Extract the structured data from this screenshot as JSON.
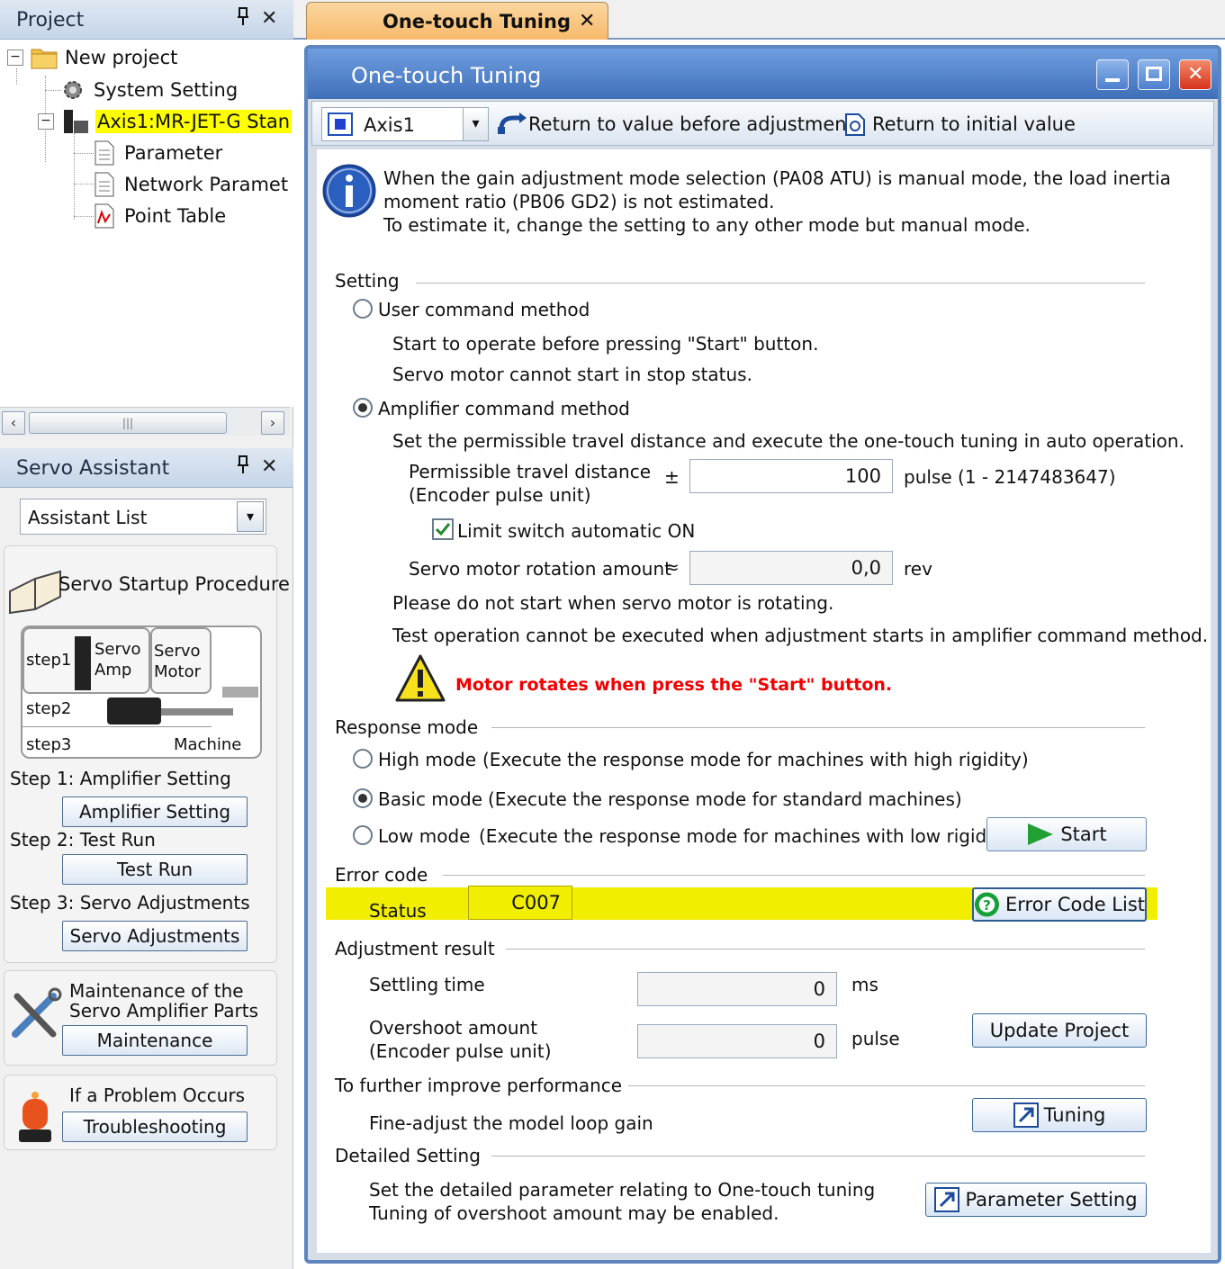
{
  "project_panel": {
    "title": "Project",
    "pin": "⊼",
    "close": "✕",
    "tree": [
      {
        "label": "New project"
      },
      {
        "label": "System Setting"
      },
      {
        "label": "Axis1:MR-JET-G Stan"
      },
      {
        "label": "Parameter"
      },
      {
        "label": "Network Paramet"
      },
      {
        "label": "Point Table"
      }
    ],
    "scroll_mid": "|||"
  },
  "assistant_panel": {
    "title": "Servo Assistant",
    "dropdown_value": "Assistant List",
    "startup": {
      "title": "Servo Startup Procedure",
      "diagram": {
        "step1": "step1",
        "step2": "step2",
        "step3": "step3",
        "servo_amp": "Servo\nAmp",
        "servo_motor": "Servo\nMotor",
        "machine": "Machine"
      },
      "step1_label": "Step 1: Amplifier Setting",
      "step1_button": "Amplifier Setting",
      "step2_label": "Step 2: Test Run",
      "step2_button": "Test Run",
      "step3_label": "Step 3: Servo Adjustments",
      "step3_button": "Servo Adjustments"
    },
    "maintenance": {
      "title1": "Maintenance of the",
      "title2": "Servo Amplifier Parts",
      "button": "Maintenance"
    },
    "problem": {
      "title": "If a Problem Occurs",
      "button": "Troubleshooting"
    }
  },
  "tab": {
    "label": "One-touch Tuning",
    "close": "✕"
  },
  "window": {
    "title": "One-touch Tuning"
  },
  "toolbar": {
    "axis_value": "Axis1",
    "return_before": "Return to value before adjustment",
    "return_initial": "Return to initial value"
  },
  "info": {
    "line1": "When the gain adjustment mode selection (PA08 ATU) is manual mode, the load inertia",
    "line2": "moment ratio (PB06 GD2) is not estimated.",
    "line3": "To estimate it, change the setting to any other mode but manual mode."
  },
  "setting": {
    "header": "Setting",
    "user_method": "User command method",
    "user_desc1": "Start to operate before pressing \"Start\" button.",
    "user_desc2": "Servo motor cannot start in stop status.",
    "amp_method": "Amplifier command method",
    "amp_desc": "Set the permissible travel distance and execute the one-touch tuning in auto operation.",
    "travel_label1": "Permissible travel distance",
    "travel_label2": "(Encoder pulse unit)",
    "plusminus": "±",
    "travel_value": "100",
    "travel_unit": "pulse (1 - 2147483647)",
    "limit_switch": "Limit switch automatic ON",
    "rotation_label": "Servo motor rotation amount",
    "approx": "≈",
    "rotation_value": "0,0",
    "rotation_unit": "rev",
    "note1": "Please do not start when servo motor is rotating.",
    "note2": "Test operation cannot be executed when adjustment starts in amplifier command method.",
    "warning": "Motor rotates when press the \"Start\" button."
  },
  "response": {
    "header": "Response mode",
    "high": "High mode",
    "high_desc": "(Execute the response mode for machines with high rigidity)",
    "basic": "Basic mode",
    "basic_desc": "(Execute the response mode for standard machines)",
    "low": "Low mode",
    "low_desc": "(Execute the response mode for machines with low rigidity)",
    "start_button": "Start",
    "selected": "Basic mode"
  },
  "error": {
    "header": "Error code",
    "status_label": "Status",
    "status_value": "C007",
    "list_button": "Error Code List",
    "highlight_color": "#f2ee00"
  },
  "adjustment": {
    "header": "Adjustment result",
    "settling_label": "Settling time",
    "settling_value": "0",
    "settling_unit": "ms",
    "overshoot_label1": "Overshoot amount",
    "overshoot_label2": "(Encoder pulse unit)",
    "overshoot_value": "0",
    "overshoot_unit": "pulse",
    "update_button": "Update Project"
  },
  "improve": {
    "header": "To further improve performance",
    "desc": "Fine-adjust the model loop gain",
    "tuning_button": "Tuning"
  },
  "detailed": {
    "header": "Detailed Setting",
    "desc1": "Set the detailed parameter relating to One-touch tuning",
    "desc2": "Tuning of overshoot amount may be enabled.",
    "param_button": "Parameter Setting"
  }
}
